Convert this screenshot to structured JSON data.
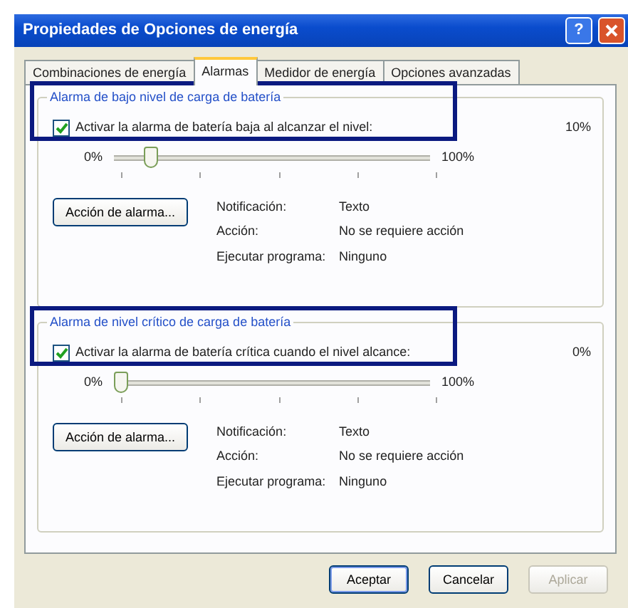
{
  "window": {
    "title": "Propiedades de Opciones de energía",
    "help_button": "?"
  },
  "tabs": [
    {
      "label": "Combinaciones de energía",
      "selected": false
    },
    {
      "label": "Alarmas",
      "selected": true
    },
    {
      "label": "Medidor de energía",
      "selected": false
    },
    {
      "label": "Opciones avanzadas",
      "selected": false
    }
  ],
  "alarms": [
    {
      "title": "Alarma de bajo nivel de carga de batería",
      "checkbox": "Activar la alarma de batería baja al alcanzar el nivel:",
      "checked": true,
      "highlighted": true,
      "reading": "10%",
      "slider_min": "0%",
      "slider_max": "100%",
      "level": 0.1,
      "action_button": "Acción de alarma...",
      "details": [
        {
          "label": "Notificación:",
          "value": "Texto"
        },
        {
          "label": "Acción:",
          "value": "No se requiere acción"
        },
        {
          "label": "Ejecutar programa:",
          "value": "Ninguno"
        }
      ]
    },
    {
      "title": "Alarma de nivel crítico de carga de batería",
      "checkbox": "Activar la alarma de batería crítica cuando el nivel alcance:",
      "checked": true,
      "highlighted": true,
      "reading": "0%",
      "slider_min": "0%",
      "slider_max": "100%",
      "level": 0,
      "action_button": "Acción de alarma...",
      "details": [
        {
          "label": "Notificación:",
          "value": "Texto"
        },
        {
          "label": "Acción:",
          "value": "No se requiere acción"
        },
        {
          "label": "Ejecutar programa:",
          "value": "Ninguno"
        }
      ]
    }
  ],
  "buttons": [
    {
      "label": "Aceptar",
      "disabled": false,
      "selected": true
    },
    {
      "label": "Cancelar",
      "disabled": false,
      "selected": false
    },
    {
      "label": "Aplicar",
      "disabled": true,
      "selected": false
    }
  ]
}
